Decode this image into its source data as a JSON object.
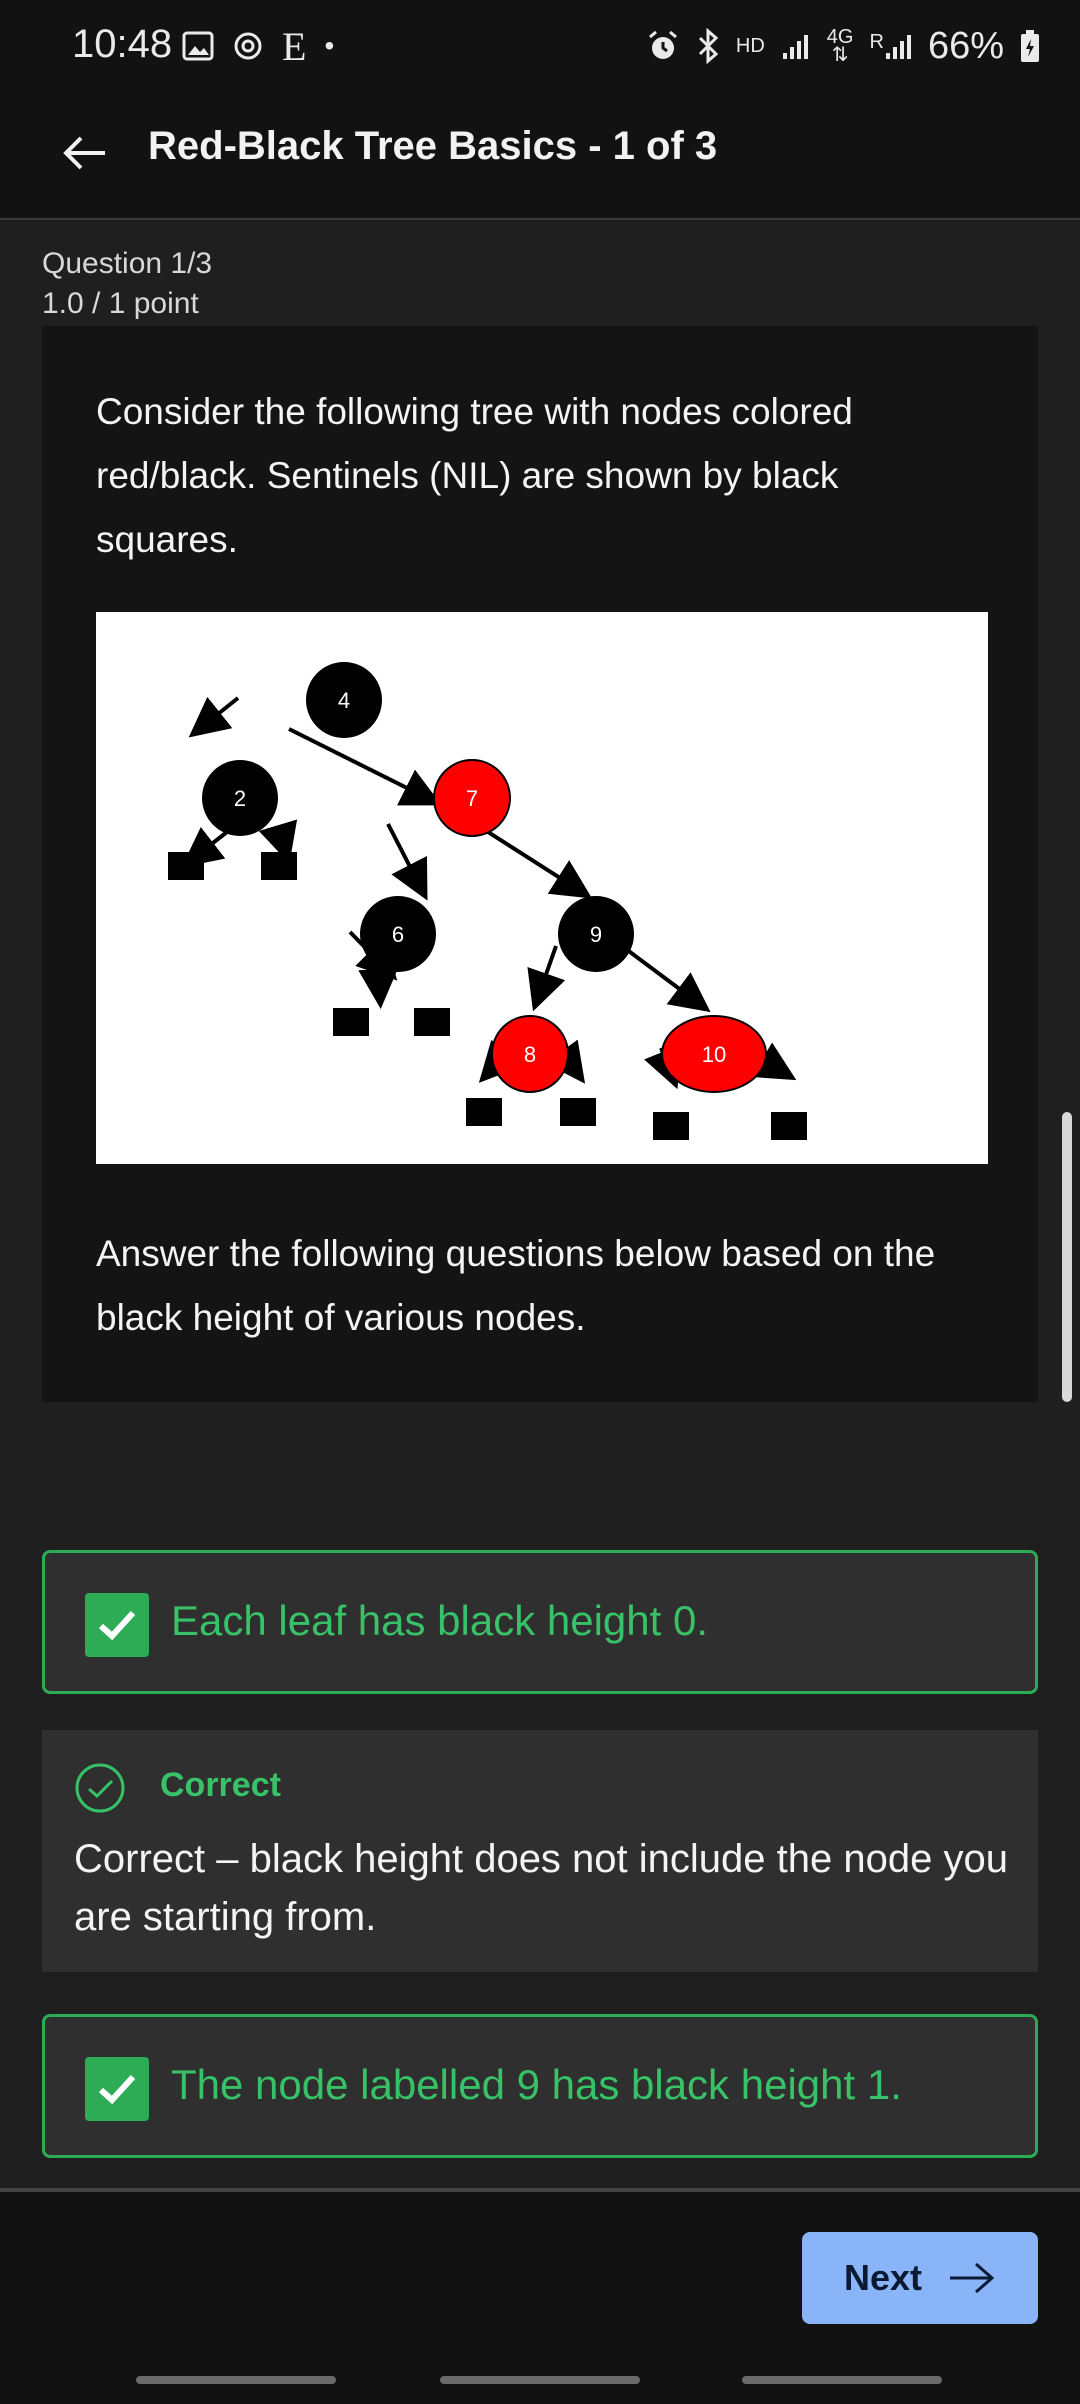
{
  "status_bar": {
    "time": "10:48",
    "left_icons": [
      "gallery-icon",
      "sync-icon",
      "e-icon",
      "dot-icon"
    ],
    "right_icons": [
      "alarm-icon",
      "bluetooth-icon",
      "hd-icon",
      "signal-icon",
      "4g-icon",
      "signal-r-icon"
    ],
    "hd_label": "HD",
    "network_label": "4G",
    "roaming_label": "R",
    "battery": "66%"
  },
  "header": {
    "title": "Red-Black Tree Basics - 1 of 3"
  },
  "question": {
    "number": "Question 1/3",
    "points": "1.0 / 1 point",
    "prompt": "Consider the following tree with nodes colored red/black. Sentinels (NIL) are shown by black squares.",
    "instruction": "Answer the following questions below based on the black height of various nodes.",
    "tree_nodes": [
      {
        "key": "4",
        "color": "black"
      },
      {
        "key": "2",
        "color": "black"
      },
      {
        "key": "7",
        "color": "red"
      },
      {
        "key": "6",
        "color": "black"
      },
      {
        "key": "9",
        "color": "black"
      },
      {
        "key": "8",
        "color": "red"
      },
      {
        "key": "10",
        "color": "red"
      }
    ],
    "colors": {
      "red_node": "#ff0000",
      "black_node": "#000000"
    }
  },
  "options": [
    {
      "label": "Each leaf has black height 0.",
      "checked": true
    },
    {
      "label": "The node labelled 9 has black height 1.",
      "checked": true
    }
  ],
  "feedback": {
    "title": "Correct",
    "text": "Correct – black height does not include the node you are starting from."
  },
  "footer": {
    "next_label": "Next"
  },
  "theme": {
    "accent_green": "#2dab55",
    "button_blue": "#8ab4f8"
  }
}
